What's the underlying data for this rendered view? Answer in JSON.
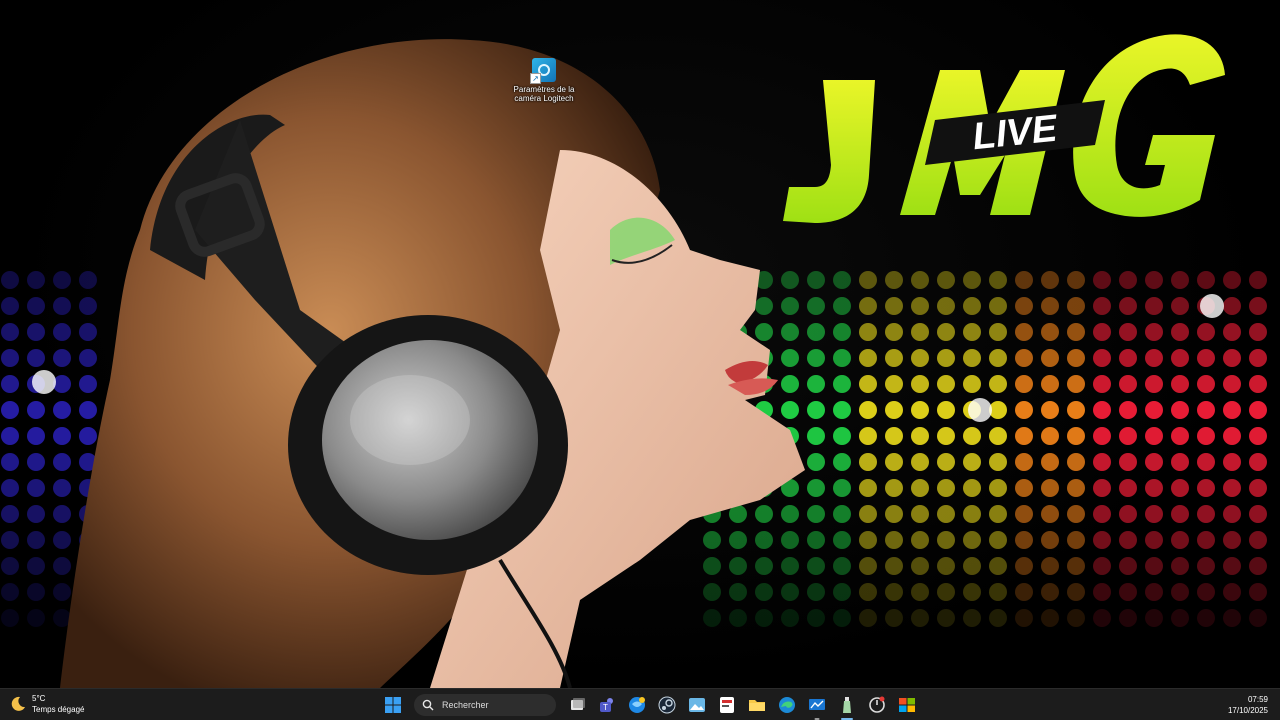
{
  "desktop": {
    "shortcut": {
      "label": "Paramètres de la caméra Logitech",
      "icon": "logitech-camera-icon"
    },
    "logo": {
      "letters": "J",
      "mid": "MG",
      "overlay": "LIVE"
    }
  },
  "taskbar": {
    "weather": {
      "temp": "5°C",
      "condition": "Temps dégagé",
      "icon": "moon-icon"
    },
    "search": {
      "placeholder": "Rechercher"
    },
    "apps": [
      {
        "name": "start",
        "icon": "windows-start-icon"
      },
      {
        "name": "task-view",
        "icon": "task-view-icon"
      },
      {
        "name": "teams",
        "icon": "teams-icon"
      },
      {
        "name": "app-blue-globe",
        "icon": "globe-icon"
      },
      {
        "name": "app-steam",
        "icon": "steam-icon"
      },
      {
        "name": "app-photos",
        "icon": "photos-icon"
      },
      {
        "name": "app-media",
        "icon": "media-app-icon"
      },
      {
        "name": "file-explorer",
        "icon": "folder-icon"
      },
      {
        "name": "edge",
        "icon": "edge-icon"
      },
      {
        "name": "app-monitor",
        "icon": "monitor-icon"
      },
      {
        "name": "app-bottle",
        "icon": "bottle-icon"
      },
      {
        "name": "app-timer",
        "icon": "timer-icon"
      },
      {
        "name": "app-store",
        "icon": "store-icon"
      }
    ],
    "time": "07:59",
    "date": "17/10/2025"
  },
  "colors": {
    "taskbar_bg": "#1c1c1c",
    "logo_green": "#b9f21a",
    "logo_yellow": "#e9f528",
    "accent": "#76b9ed"
  }
}
